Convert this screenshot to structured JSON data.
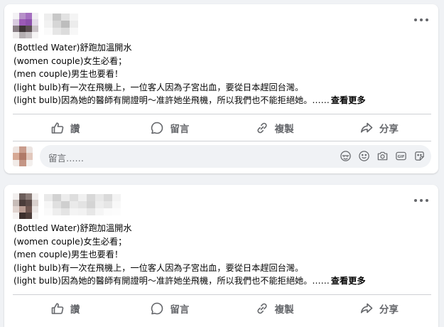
{
  "posts": [
    {
      "body": {
        "lines": [
          "(Bottled Water)舒跑加溫開水",
          "(women couple)女生必看；",
          "(men couple)男生也要看！",
          "(light bulb)有一次在飛機上，一位客人因為子宮出血，要從日本趕回台灣。",
          "(light bulb)因為她的醫師有開證明～准許她坐飛機，所以我們也不能拒絕她。……"
        ],
        "see_more": "查看更多"
      },
      "actions": {
        "like": "讚",
        "comment": "留言",
        "copy": "複製",
        "share": "分享"
      },
      "comment_box": {
        "placeholder": "留言……"
      }
    },
    {
      "body": {
        "lines": [
          "(Bottled Water)舒跑加溫開水",
          "(women couple)女生必看；",
          "(men couple)男生也要看！",
          "(light bulb)有一次在飛機上，一位客人因為子宮出血，要從日本趕回台灣。",
          "(light bulb)因為她的醫師有開證明～准許她坐飛機，所以我們也不能拒絕她。……"
        ],
        "see_more": "查看更多"
      },
      "actions": {
        "like": "讚",
        "comment": "留言",
        "copy": "複製",
        "share": "分享"
      }
    }
  ],
  "icons": {
    "more": "more-horizontal-icon",
    "like": "thumbs-up-icon",
    "comment": "speech-bubble-icon",
    "copy": "link-chain-icon",
    "share": "share-arrow-icon",
    "comment_tools": [
      "avatar-sticker-icon",
      "emoji-icon",
      "camera-icon",
      "gif-icon",
      "sticker-icon"
    ]
  },
  "colors": {
    "background": "#f0f2f5",
    "card": "#ffffff",
    "secondary_text": "#65676b",
    "divider": "#ced0d4"
  }
}
